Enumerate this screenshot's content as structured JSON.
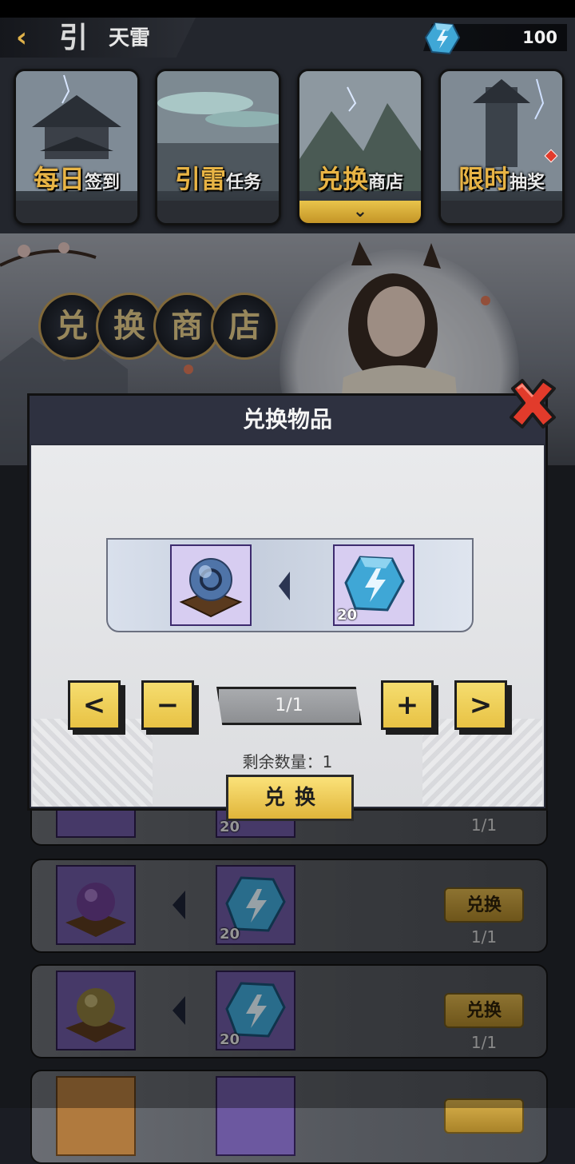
{
  "header": {
    "back_icon": "chevron-left-icon",
    "title_glyph": "引",
    "title": "天雷",
    "currency": {
      "icon": "lightning-gem-icon",
      "value": "100"
    }
  },
  "tabs": [
    {
      "big": "每日",
      "small": "签到",
      "active": false,
      "badge": false
    },
    {
      "big": "引雷",
      "small": "任务",
      "active": false,
      "badge": false
    },
    {
      "big": "兑换",
      "small": "商店",
      "active": true,
      "badge": false
    },
    {
      "big": "限时",
      "small": "抽奖",
      "active": false,
      "badge": true
    }
  ],
  "banner": {
    "title_chars": [
      "兑",
      "换",
      "商",
      "店"
    ]
  },
  "list": {
    "rows": [
      {
        "item_color": "#7d8fb6",
        "cost": "20",
        "button": "",
        "count": "1/1"
      },
      {
        "item_color": "#6b3e8f",
        "cost": "20",
        "button": "兑换",
        "count": "1/1"
      },
      {
        "item_color": "#8a7a3c",
        "cost": "20",
        "button": "兑换",
        "count": "1/1"
      },
      {
        "item_color": "#b57a3e",
        "cost": "",
        "button": "",
        "count": ""
      }
    ]
  },
  "modal": {
    "title": "兑换物品",
    "reward_item": "blue-orb-icon",
    "cost_item": "lightning-gem-icon",
    "cost_amount": "20",
    "controls": {
      "prev": "<",
      "minus": "−",
      "quantity": "1/1",
      "plus": "+",
      "next": ">"
    },
    "remaining_label": "剩余数量：",
    "remaining_value": "1",
    "exchange_button": "兑换",
    "close_icon": "close-x-icon"
  },
  "colors": {
    "accent_gold": "#e8c244",
    "close_red": "#e23b2b",
    "gem_blue": "#3fa7d6"
  }
}
